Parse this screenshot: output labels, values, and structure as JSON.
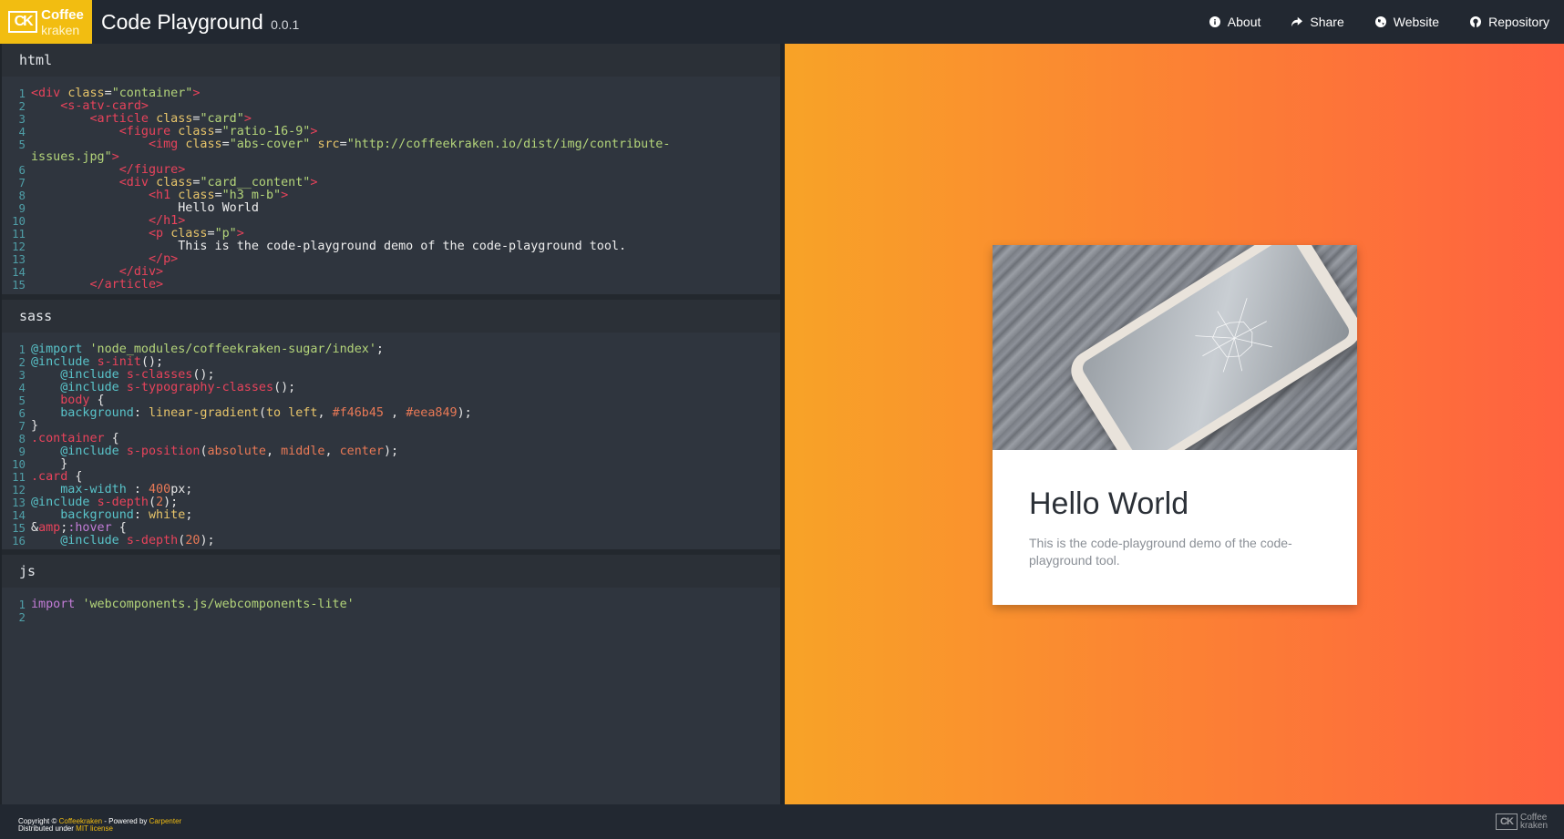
{
  "header": {
    "logo": {
      "mark": "CK",
      "line1": "Coffee",
      "line2": "kraken"
    },
    "title": "Code Playground",
    "version": "0.0.1",
    "nav": [
      {
        "label": "About",
        "icon": "info-icon"
      },
      {
        "label": "Share",
        "icon": "share-icon"
      },
      {
        "label": "Website",
        "icon": "globe-icon"
      },
      {
        "label": "Repository",
        "icon": "github-icon"
      }
    ]
  },
  "editors": {
    "html": {
      "title": "html"
    },
    "sass": {
      "title": "sass"
    },
    "js": {
      "title": "js"
    }
  },
  "preview": {
    "card": {
      "title": "Hello World",
      "text": "This is the code-playground demo of the code-playground tool."
    }
  },
  "footer": {
    "copyright_prefix": "Copyright ©",
    "company": "Coffeekraken",
    "powered_prefix": " - Powered by",
    "powered_by": "Carpenter",
    "distributed_prefix": "Distributed under",
    "license": "MIT license",
    "logo_mark": "CK",
    "logo_line1": "Coffee",
    "logo_line2": "kraken"
  },
  "colors": {
    "accent": "#f2bd11",
    "header_bg": "#222831",
    "editor_bg": "#2f353e",
    "gradient_start": "#f46b45",
    "gradient_end": "#eea849"
  }
}
